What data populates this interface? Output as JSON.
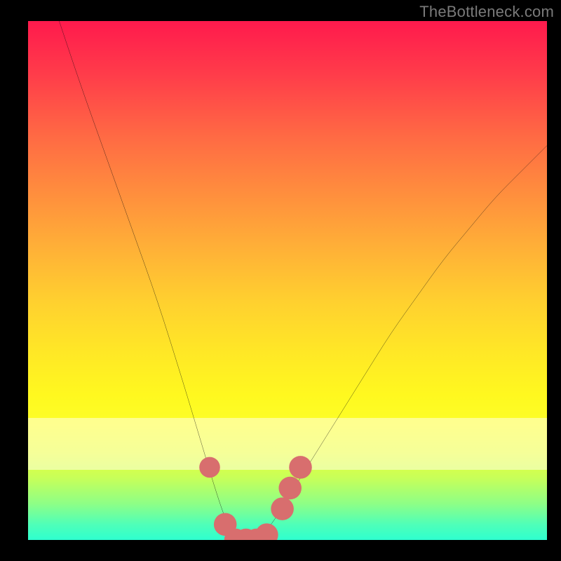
{
  "watermark": "TheBottleneck.com",
  "colors": {
    "background_black": "#000000",
    "gradient_top": "#ff1a4d",
    "gradient_bottom": "#2effcf",
    "curve_stroke": "#0b0b0b",
    "marker_fill": "#d86e6e",
    "watermark_text": "#7a7a7a"
  },
  "chart_data": {
    "type": "line",
    "title": "",
    "xlabel": "",
    "ylabel": "",
    "xlim": [
      0,
      100
    ],
    "ylim": [
      0,
      100
    ],
    "legend": false,
    "grid": false,
    "series": [
      {
        "name": "bottleneck-curve",
        "x": [
          6,
          10,
          15,
          20,
          25,
          30,
          33,
          36,
          38,
          40,
          42,
          44,
          47,
          50,
          55,
          60,
          65,
          70,
          75,
          80,
          85,
          90,
          95,
          100
        ],
        "y": [
          100,
          88,
          74,
          60,
          46,
          30,
          20,
          10,
          4,
          0,
          0,
          0,
          3,
          8,
          16,
          24,
          32,
          40,
          47,
          54,
          60,
          66,
          71,
          76
        ]
      }
    ],
    "markers": [
      {
        "name": "left-shoulder-marker",
        "x": 35,
        "y": 14,
        "r": 2.0
      },
      {
        "name": "valley-left-marker",
        "x": 38,
        "y": 3,
        "r": 2.2
      },
      {
        "name": "valley-floor-marker-1",
        "x": 40,
        "y": 0,
        "r": 2.2
      },
      {
        "name": "valley-floor-marker-2",
        "x": 42,
        "y": 0,
        "r": 2.2
      },
      {
        "name": "valley-floor-marker-3",
        "x": 44,
        "y": 0,
        "r": 2.2
      },
      {
        "name": "valley-floor-marker-4",
        "x": 46,
        "y": 1,
        "r": 2.2
      },
      {
        "name": "right-rise-marker-1",
        "x": 49,
        "y": 6,
        "r": 2.2
      },
      {
        "name": "right-rise-marker-2",
        "x": 50.5,
        "y": 10,
        "r": 2.2
      },
      {
        "name": "right-rise-marker-3",
        "x": 52.5,
        "y": 14,
        "r": 2.2
      }
    ],
    "valley_floor_bar": {
      "x_start": 39,
      "x_end": 47,
      "y": 0,
      "thickness_pct": 1.6
    }
  }
}
